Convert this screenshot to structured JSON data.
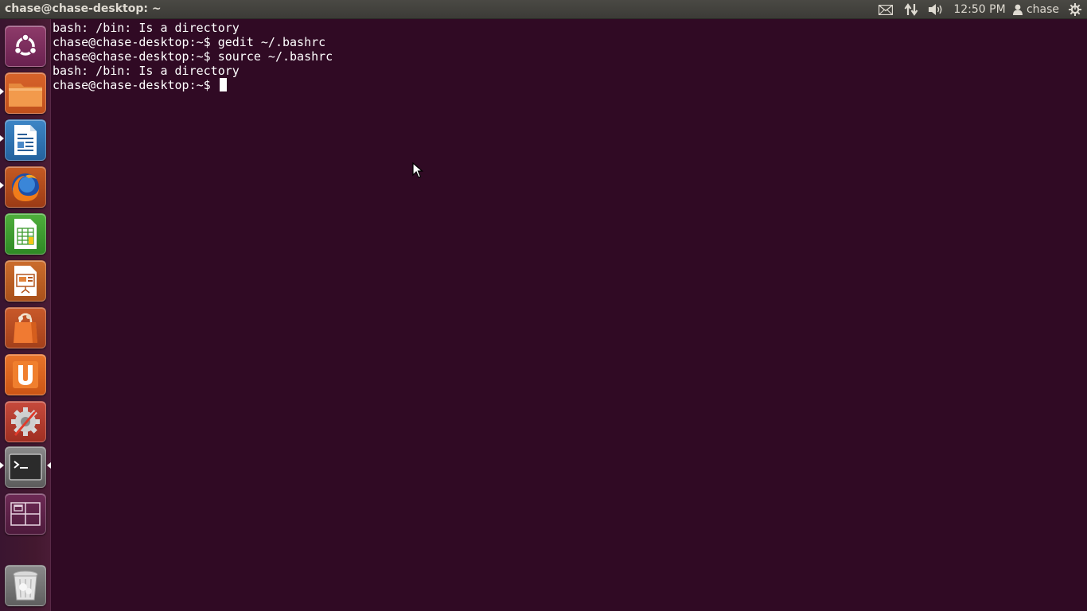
{
  "panel": {
    "window_title": "chase@chase-desktop: ~",
    "clock": "12:50 PM",
    "user_name": "chase",
    "indicators": {
      "mail": "mail-icon",
      "network": "network-updown-icon",
      "sound": "speaker-icon",
      "user": "user-icon",
      "session": "gear-power-icon"
    }
  },
  "launcher": {
    "items": [
      {
        "name": "dash-home",
        "icon": "ubuntu-logo-icon",
        "running": false
      },
      {
        "name": "files",
        "icon": "folder-icon",
        "running": true
      },
      {
        "name": "libreoffice-writer",
        "icon": "writer-document-icon",
        "running": true
      },
      {
        "name": "firefox",
        "icon": "firefox-icon",
        "running": true
      },
      {
        "name": "libreoffice-calc",
        "icon": "calc-spreadsheet-icon",
        "running": false
      },
      {
        "name": "libreoffice-impress",
        "icon": "impress-presentation-icon",
        "running": false
      },
      {
        "name": "software-center",
        "icon": "shopping-bag-icon",
        "running": false
      },
      {
        "name": "ubuntu-one",
        "icon": "ubuntu-one-icon",
        "running": false
      },
      {
        "name": "system-settings",
        "icon": "settings-wrench-icon",
        "running": false
      },
      {
        "name": "terminal",
        "icon": "terminal-icon",
        "running": true,
        "focused": true
      },
      {
        "name": "workspace-switcher",
        "icon": "workspaces-icon",
        "running": false
      },
      {
        "name": "trash",
        "icon": "trash-icon",
        "running": false
      }
    ]
  },
  "terminal": {
    "lines": [
      "bash: /bin: Is a directory",
      "chase@chase-desktop:~$ gedit ~/.bashrc",
      "chase@chase-desktop:~$ source ~/.bashrc",
      "bash: /bin: Is a directory"
    ],
    "prompt": "chase@chase-desktop:~$ "
  },
  "colors": {
    "terminal_bg": "#300a24",
    "panel_bg": "#3c3b37",
    "text": "#ffffff"
  }
}
